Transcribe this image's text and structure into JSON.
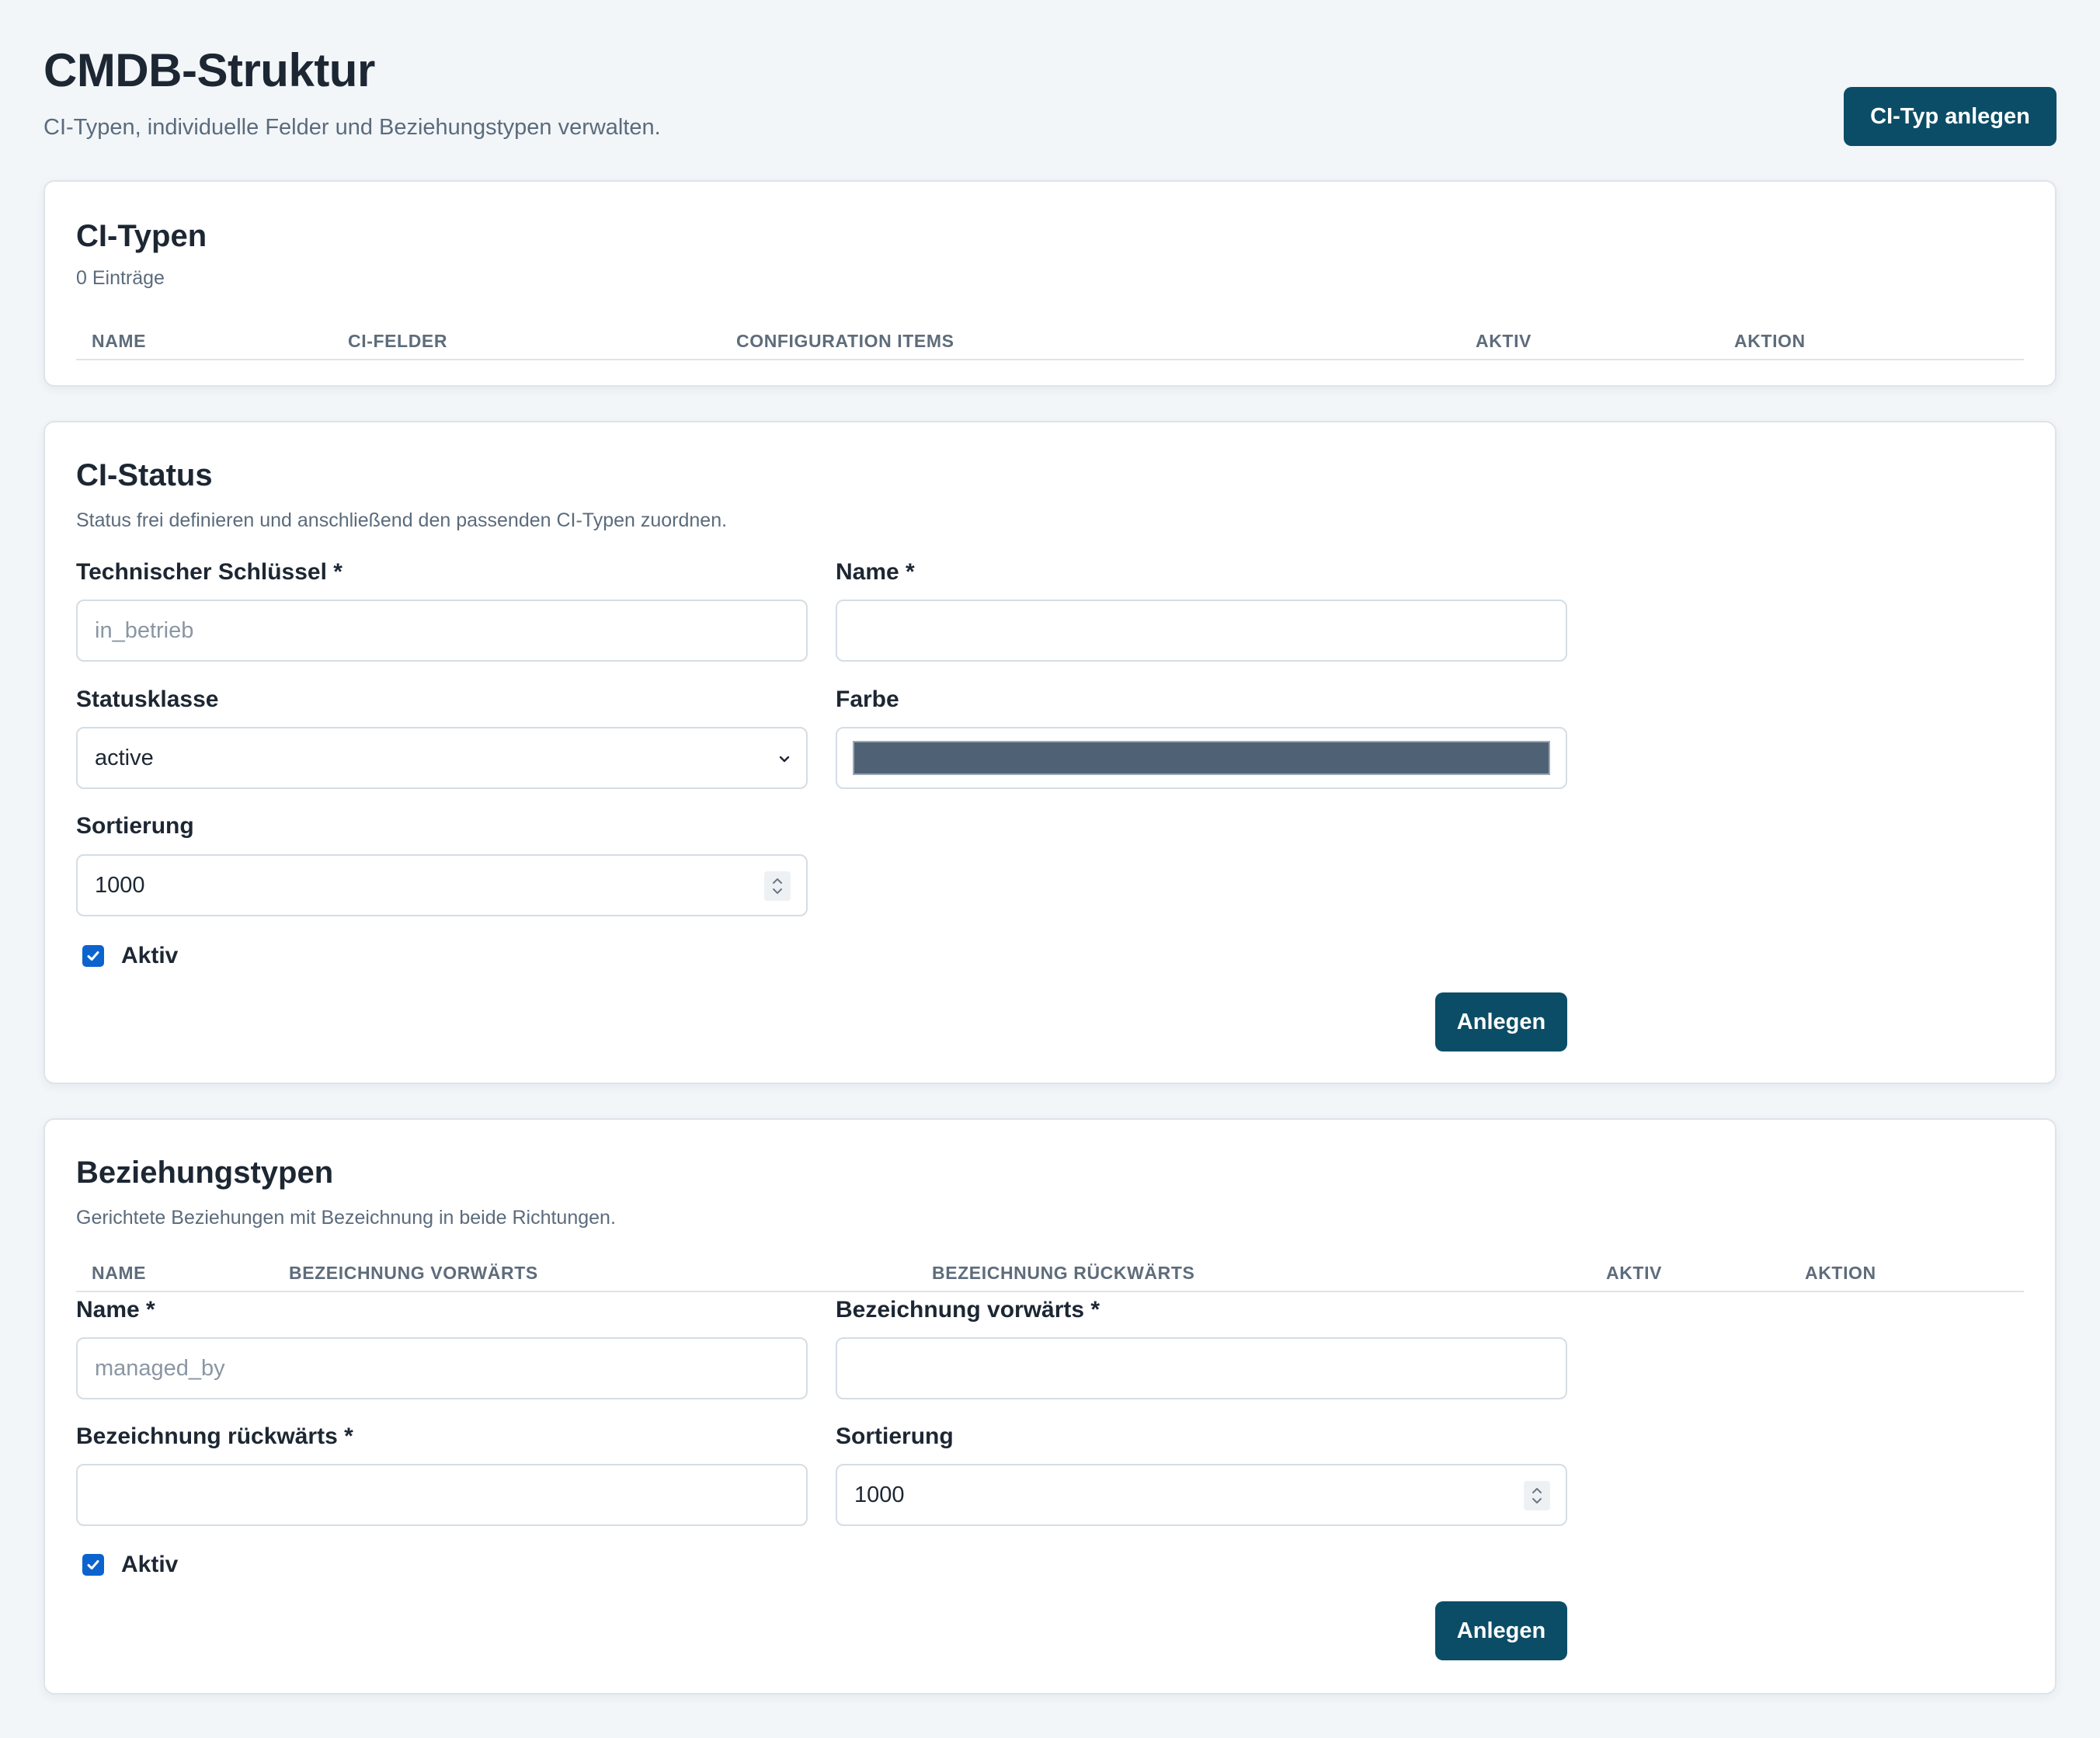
{
  "header": {
    "title": "CMDB-Struktur",
    "subtitle": "CI-Typen, individuelle Felder und Beziehungstypen verwalten.",
    "create_button": "CI-Typ anlegen"
  },
  "ci_types": {
    "title": "CI-Typen",
    "count": "0 Einträge",
    "columns": [
      "NAME",
      "CI-FELDER",
      "CONFIGURATION ITEMS",
      "AKTIV",
      "AKTION"
    ],
    "rows": []
  },
  "ci_status": {
    "title": "CI-Status",
    "description": "Status frei definieren und anschließend den passenden CI-Typen zuordnen.",
    "key_label": "Technischer Schlüssel *",
    "key_placeholder": "in_betrieb",
    "key_value": "",
    "name_label": "Name *",
    "name_value": "",
    "class_label": "Statusklasse",
    "class_value": "active",
    "color_label": "Farbe",
    "color_value": "#4f6275",
    "sort_label": "Sortierung",
    "sort_value": "1000",
    "active_label": "Aktiv",
    "active_checked": true,
    "submit": "Anlegen"
  },
  "relation_types": {
    "title": "Beziehungstypen",
    "description": "Gerichtete Beziehungen mit Bezeichnung in beide Richtungen.",
    "columns": [
      "NAME",
      "BEZEICHNUNG VORWÄRTS",
      "BEZEICHNUNG RÜCKWÄRTS",
      "AKTIV",
      "AKTION"
    ],
    "rows": [],
    "name_label": "Name *",
    "name_placeholder": "managed_by",
    "name_value": "",
    "forward_label": "Bezeichnung vorwärts *",
    "forward_value": "",
    "backward_label": "Bezeichnung rückwärts *",
    "backward_value": "",
    "sort_label": "Sortierung",
    "sort_value": "1000",
    "active_label": "Aktiv",
    "active_checked": true,
    "submit": "Anlegen"
  },
  "colors": {
    "primary": "#0b4d66",
    "checkbox": "#0b63ce",
    "background": "#f2f6f9"
  }
}
